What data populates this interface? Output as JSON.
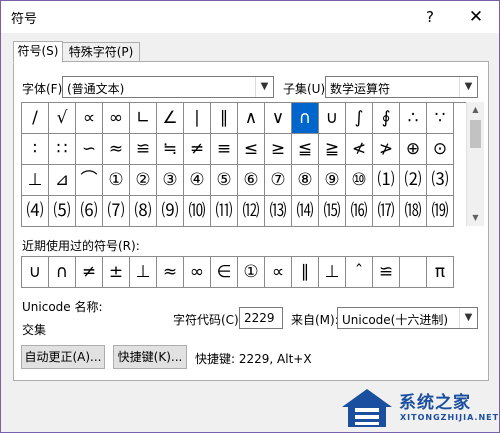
{
  "window": {
    "title": "符号",
    "help": "?",
    "close": "✕"
  },
  "tabs": [
    {
      "label": "符号(S)",
      "active": true
    },
    {
      "label": "特殊字符(P)",
      "active": false
    }
  ],
  "font": {
    "label": "字体(F):",
    "value": "(普通文本)"
  },
  "subset": {
    "label": "子集(U):",
    "value": "数学运算符"
  },
  "grid": {
    "rows": [
      [
        "/",
        "√",
        "∝",
        "∞",
        "∟",
        "∠",
        "∣",
        "∥",
        "∧",
        "∨",
        "∩",
        "∪",
        "∫",
        "∮",
        "∴",
        "∵"
      ],
      [
        "∶",
        "∷",
        "∽",
        "≈",
        "≌",
        "≒",
        "≠",
        "≡",
        "≤",
        "≥",
        "≦",
        "≧",
        "≮",
        "≯",
        "⊕",
        "⊙"
      ],
      [
        "⊥",
        "⊿",
        "⌒",
        "①",
        "②",
        "③",
        "④",
        "⑤",
        "⑥",
        "⑦",
        "⑧",
        "⑨",
        "⑩",
        "⑴",
        "⑵",
        "⑶"
      ],
      [
        "⑷",
        "⑸",
        "⑹",
        "⑺",
        "⑻",
        "⑼",
        "⑽",
        "⑾",
        "⑿",
        "⒀",
        "⒁",
        "⒂",
        "⒃",
        "⒄",
        "⒅",
        "⒆"
      ]
    ],
    "selected_row": 0,
    "selected_col": 10
  },
  "recent": {
    "label": "近期使用过的符号(R):",
    "symbols": [
      "∪",
      "∩",
      "≠",
      "±",
      "⊥",
      "≈",
      "∞",
      "∈",
      "①",
      "∝",
      "∥",
      "⊥",
      "ˆ",
      "≌",
      "",
      "π"
    ]
  },
  "unicode_name": {
    "label": "Unicode 名称:",
    "value": "交集"
  },
  "char_code": {
    "label": "字符代码(C):",
    "value": "2229"
  },
  "from": {
    "label": "来自(M):",
    "value": "Unicode(十六进制)"
  },
  "buttons": {
    "autocorrect": "自动更正(A)...",
    "shortcut_key": "快捷键(K)..."
  },
  "shortcut_text": "快捷键: 2229, Alt+X",
  "watermark": {
    "name": "系统之家",
    "url": "XITONGZHIJIA.NET"
  },
  "colors": {
    "selection": "#0066cc",
    "border": "#7a5fa8",
    "watermark": "#1a4f9f"
  }
}
